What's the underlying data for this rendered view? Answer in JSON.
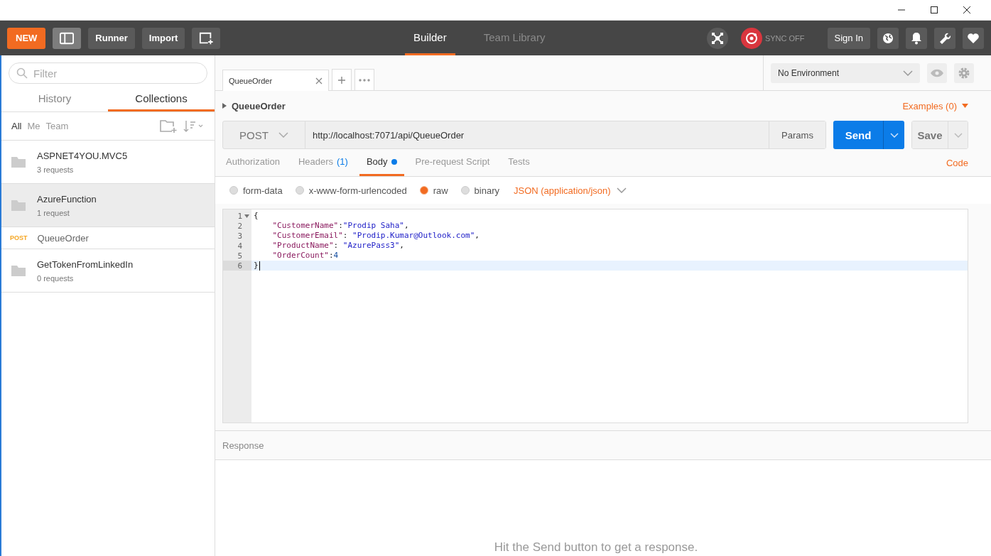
{
  "header": {
    "new_button": "NEW",
    "runner_button": "Runner",
    "import_button": "Import",
    "nav_tabs": [
      {
        "label": "Builder",
        "selected": true
      },
      {
        "label": "Team Library",
        "selected": false
      }
    ],
    "sync_status": "SYNC OFF",
    "sign_in_button": "Sign In"
  },
  "sidebar": {
    "filter_placeholder": "Filter",
    "tabs": [
      {
        "label": "History",
        "selected": false
      },
      {
        "label": "Collections",
        "selected": true
      }
    ],
    "owner_filters": [
      {
        "label": "All",
        "selected": true
      },
      {
        "label": "Me",
        "selected": false
      },
      {
        "label": "Team",
        "selected": false
      }
    ],
    "collections": [
      {
        "name": "ASPNET4YOU.MVC5",
        "count": "3 requests",
        "selected": false
      },
      {
        "name": "AzureFunction",
        "count": "1 request",
        "selected": true,
        "children": [
          {
            "method": "POST",
            "name": "QueueOrder"
          }
        ]
      },
      {
        "name": "GetTokenFromLinkedIn",
        "count": "0 requests",
        "selected": false
      }
    ]
  },
  "request_tabs": [
    {
      "label": "QueueOrder",
      "selected": true
    }
  ],
  "environment": "No Environment",
  "request": {
    "name": "QueueOrder",
    "examples": "Examples (0)",
    "method": "POST",
    "url": "http://localhost:7071/api/QueueOrder",
    "params_button": "Params",
    "send_button": "Send",
    "save_button": "Save"
  },
  "subtabs": [
    {
      "label": "Authorization",
      "selected": false,
      "modified": false
    },
    {
      "label": "Headers",
      "badge": "(1)",
      "selected": false,
      "modified": false
    },
    {
      "label": "Body",
      "selected": true,
      "modified": true
    },
    {
      "label": "Pre-request Script",
      "selected": false,
      "modified": false
    },
    {
      "label": "Tests",
      "selected": false,
      "modified": false
    }
  ],
  "code_link": "Code",
  "body_modes": [
    {
      "label": "form-data",
      "selected": false
    },
    {
      "label": "x-www-form-urlencoded",
      "selected": false
    },
    {
      "label": "raw",
      "selected": true
    },
    {
      "label": "binary",
      "selected": false
    }
  ],
  "content_type": "JSON (application/json)",
  "editor_lines": [
    {
      "number": "1",
      "active": false,
      "foldable": true,
      "tokens": [
        {
          "kind": "punct",
          "text": "{"
        }
      ]
    },
    {
      "number": "2",
      "active": false,
      "foldable": false,
      "tokens": [
        {
          "kind": "key",
          "text": "    \"CustomerName\""
        },
        {
          "kind": "punct",
          "text": ":"
        },
        {
          "kind": "string",
          "text": "\"Prodip Saha\""
        },
        {
          "kind": "punct",
          "text": ","
        }
      ]
    },
    {
      "number": "3",
      "active": false,
      "foldable": false,
      "tokens": [
        {
          "kind": "key",
          "text": "    \"CustomerEmail\""
        },
        {
          "kind": "punct",
          "text": ": "
        },
        {
          "kind": "string",
          "text": "\"Prodip.Kumar@Outlook.com\""
        },
        {
          "kind": "punct",
          "text": ","
        }
      ]
    },
    {
      "number": "4",
      "active": false,
      "foldable": false,
      "tokens": [
        {
          "kind": "key",
          "text": "    \"ProductName\""
        },
        {
          "kind": "punct",
          "text": ": "
        },
        {
          "kind": "string",
          "text": "\"AzurePass3\""
        },
        {
          "kind": "punct",
          "text": ","
        }
      ]
    },
    {
      "number": "5",
      "active": false,
      "foldable": false,
      "tokens": [
        {
          "kind": "key",
          "text": "    \"OrderCount\""
        },
        {
          "kind": "punct",
          "text": ":"
        },
        {
          "kind": "number",
          "text": "4"
        }
      ]
    },
    {
      "number": "6",
      "active": true,
      "foldable": false,
      "tokens": [
        {
          "kind": "punct",
          "text": "}"
        }
      ]
    }
  ],
  "response": {
    "label": "Response",
    "hint": "Hit the Send button to get a response."
  }
}
